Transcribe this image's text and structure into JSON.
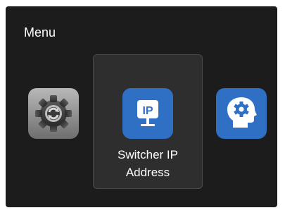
{
  "menu": {
    "title": "Menu",
    "items": [
      {
        "name": "settings",
        "icon": "gear-icon",
        "color": "#8f8f8f"
      },
      {
        "name": "switcher-ip-address",
        "icon": "ip-monitor-icon",
        "color": "#2f6fc4",
        "label_line1": "Switcher IP",
        "label_line2": "Address",
        "selected": true
      },
      {
        "name": "head-gear",
        "icon": "head-gear-icon",
        "color": "#2f6fc4"
      }
    ]
  },
  "colors": {
    "background": "#1c1c1c",
    "highlight": "#2e2e2e",
    "accent": "#2f6fc4"
  }
}
